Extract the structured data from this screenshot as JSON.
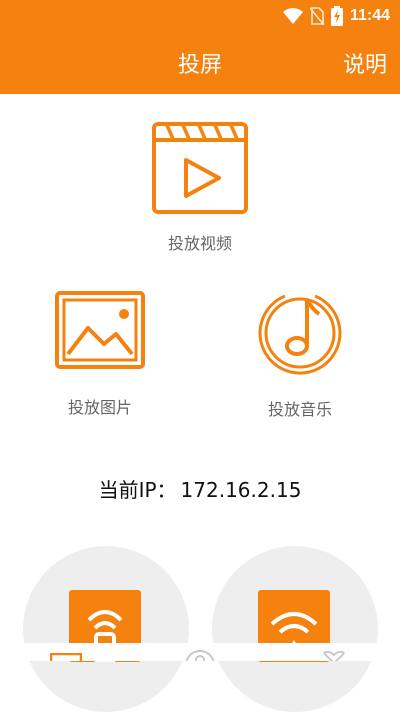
{
  "status_bar": {
    "time": "11:44",
    "icons": [
      "wifi-icon",
      "no-sim-icon",
      "battery-charging-icon"
    ]
  },
  "app_bar": {
    "title": "投屏",
    "help_label": "说明"
  },
  "features": {
    "video": {
      "label": "投放视频",
      "icon": "video-clapper-play-icon"
    },
    "image": {
      "label": "投放图片",
      "icon": "image-landscape-icon"
    },
    "music": {
      "label": "投放音乐",
      "icon": "music-note-icon"
    }
  },
  "ip": {
    "label": "当前IP：",
    "value": "172.16.2.15"
  },
  "cast_buttons": [
    {
      "icon": "remote-cast-icon"
    },
    {
      "icon": "wifi-cast-icon"
    }
  ],
  "bottom_nav": {
    "tabs": [
      {
        "icon": "tab-home-icon"
      },
      {
        "icon": "tab-profile-icon"
      },
      {
        "icon": "tab-favorite-icon"
      }
    ]
  },
  "colors": {
    "accent": "#f5820f",
    "text": "#111111",
    "label": "#666666",
    "circle": "#eeeeee"
  }
}
